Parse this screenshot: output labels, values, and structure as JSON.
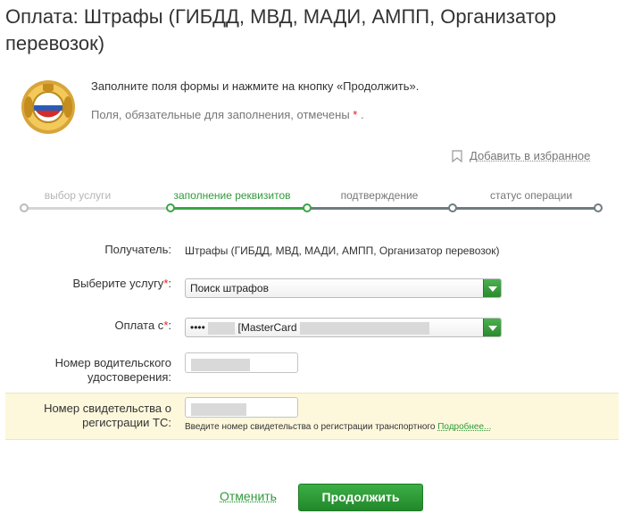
{
  "header": {
    "title": "Оплата: Штрафы (ГИБДД, МВД, МАДИ, АМПП, Организатор перевозок)"
  },
  "intro": {
    "line1": "Заполните поля формы и нажмите на кнопку «Продолжить».",
    "line2": "Поля, обязательные для заполнения, отмечены",
    "required_mark": "*",
    "line2_end": "."
  },
  "favorites": {
    "label": "Добавить в избранное",
    "icon": "bookmark-icon"
  },
  "steps": [
    {
      "label": "выбор услуги",
      "state": "done"
    },
    {
      "label": "заполнение реквизитов",
      "state": "active"
    },
    {
      "label": "подтверждение",
      "state": "pending"
    },
    {
      "label": "статус операции",
      "state": "pending"
    }
  ],
  "form": {
    "recipient": {
      "label": "Получатель:",
      "value": "Штрафы (ГИБДД, МВД, МАДИ, АМПП, Организатор перевозок)"
    },
    "service": {
      "label": "Выберите услугу",
      "required": "*",
      "colon": ":",
      "value": "Поиск штрафов"
    },
    "payment_from": {
      "label": "Оплата с",
      "required": "*",
      "colon": ":",
      "masked_prefix": "••••",
      "card_name": "[MasterCard"
    },
    "license": {
      "label": "Номер водительского удостоверения:"
    },
    "registration": {
      "label": "Номер свидетельства о регистрации ТС:",
      "hint": "Введите номер свидетельства о регистрации транспортного",
      "hint_link": "Подробнее..."
    }
  },
  "actions": {
    "cancel": "Отменить",
    "continue": "Продолжить"
  },
  "colors": {
    "accent": "#2f9b3a",
    "button": "#21882a",
    "highlight": "#fdf8dc"
  }
}
